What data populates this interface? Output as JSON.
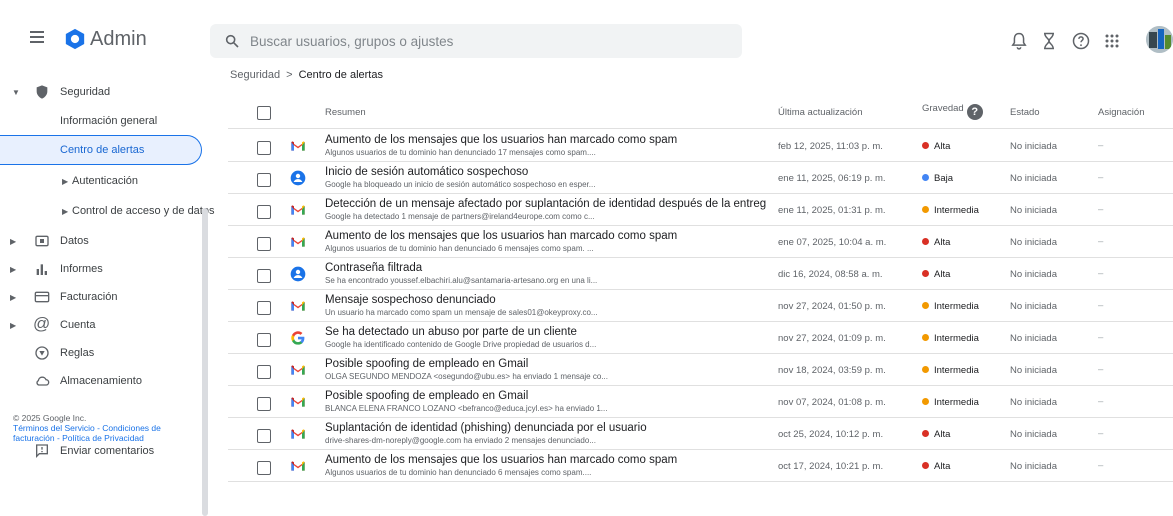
{
  "app": {
    "title": "Admin"
  },
  "search": {
    "placeholder": "Buscar usuarios, grupos o ajustes",
    "value": ""
  },
  "breadcrumb": {
    "parent": "Seguridad",
    "separator": ">",
    "current": "Centro de alertas"
  },
  "sidebar": {
    "security_label": "Seguridad",
    "items": [
      {
        "label": "Información general"
      },
      {
        "label": "Centro de alertas",
        "active": true
      },
      {
        "label": "Autenticación"
      },
      {
        "label": "Control de acceso y de datos"
      }
    ],
    "sections": [
      {
        "label": "Datos",
        "icon": "data-icon"
      },
      {
        "label": "Informes",
        "icon": "bar-chart-icon"
      },
      {
        "label": "Facturación",
        "icon": "credit-card-icon"
      },
      {
        "label": "Cuenta",
        "icon": "at-sign-icon"
      },
      {
        "label": "Reglas",
        "icon": "rules-icon"
      },
      {
        "label": "Almacenamiento",
        "icon": "cloud-icon"
      }
    ],
    "feedback_label": "Enviar comentarios",
    "footer": {
      "copyright": "© 2025 Google Inc.",
      "links_line1": "Términos del Servicio - Condiciones de",
      "links_line2": "facturación - Política de Privacidad"
    }
  },
  "table": {
    "headers": {
      "summary": "Resumen",
      "updated": "Última actualización",
      "severity": "Gravedad",
      "status": "Estado",
      "assignment": "Asignación"
    },
    "severity_colors": {
      "Alta": "#d93025",
      "Baja": "#4285f4",
      "Intermedia": "#f29900"
    },
    "rows": [
      {
        "service": "gmail",
        "title": "Aumento de los mensajes que los usuarios han marcado como spam",
        "desc": "Algunos usuarios de tu dominio han denunciado 17 mensajes como spam....",
        "date": "feb 12, 2025, 11:03 p. m.",
        "severity": "Alta",
        "status": "No iniciada",
        "assign": "–"
      },
      {
        "service": "account",
        "title": "Inicio de sesión automático sospechoso",
        "desc": "Google ha bloqueado un inicio de sesión automático sospechoso en esper...",
        "date": "ene 11, 2025, 06:19 p. m.",
        "severity": "Baja",
        "status": "No iniciada",
        "assign": "–"
      },
      {
        "service": "gmail",
        "title": "Detección de un mensaje afectado por suplantación de identidad después de la entreg",
        "desc": "Google ha detectado 1 mensaje de partners@ireland4europe.com como c...",
        "date": "ene 11, 2025, 01:31 p. m.",
        "severity": "Intermedia",
        "status": "No iniciada",
        "assign": "–"
      },
      {
        "service": "gmail",
        "title": "Aumento de los mensajes que los usuarios han marcado como spam",
        "desc": "Algunos usuarios de tu dominio han denunciado 6 mensajes como spam. ...",
        "date": "ene 07, 2025, 10:04 a. m.",
        "severity": "Alta",
        "status": "No iniciada",
        "assign": "–"
      },
      {
        "service": "account",
        "title": "Contraseña filtrada",
        "desc": "Se ha encontrado youssef.elbachiri.alu@santamaria-artesano.org en una li...",
        "date": "dic 16, 2024, 08:58 a. m.",
        "severity": "Alta",
        "status": "No iniciada",
        "assign": "–"
      },
      {
        "service": "gmail",
        "title": "Mensaje sospechoso denunciado",
        "desc": "Un usuario ha marcado como spam un mensaje de sales01@okeyproxy.co...",
        "date": "nov 27, 2024, 01:50 p. m.",
        "severity": "Intermedia",
        "status": "No iniciada",
        "assign": "–"
      },
      {
        "service": "google",
        "title": "Se ha detectado un abuso por parte de un cliente",
        "desc": "Google ha identificado contenido de Google Drive propiedad de usuarios d...",
        "date": "nov 27, 2024, 01:09 p. m.",
        "severity": "Intermedia",
        "status": "No iniciada",
        "assign": "–"
      },
      {
        "service": "gmail",
        "title": "Posible spoofing de empleado en Gmail",
        "desc": "OLGA SEGUNDO MENDOZA <osegundo@ubu.es> ha enviado 1 mensaje co...",
        "date": "nov 18, 2024, 03:59 p. m.",
        "severity": "Intermedia",
        "status": "No iniciada",
        "assign": "–"
      },
      {
        "service": "gmail",
        "title": "Posible spoofing de empleado en Gmail",
        "desc": "BLANCA ELENA FRANCO LOZANO <befranco@educa.jcyl.es> ha enviado 1...",
        "date": "nov 07, 2024, 01:08 p. m.",
        "severity": "Intermedia",
        "status": "No iniciada",
        "assign": "–"
      },
      {
        "service": "gmail",
        "title": "Suplantación de identidad (phishing) denunciada por el usuario",
        "desc": "drive-shares-dm-noreply@google.com ha enviado 2 mensajes denunciado...",
        "date": "oct 25, 2024, 10:12 p. m.",
        "severity": "Alta",
        "status": "No iniciada",
        "assign": "–"
      },
      {
        "service": "gmail",
        "title": "Aumento de los mensajes que los usuarios han marcado como spam",
        "desc": "Algunos usuarios de tu dominio han denunciado 6 mensajes como spam....",
        "date": "oct 17, 2024, 10:21 p. m.",
        "severity": "Alta",
        "status": "No iniciada",
        "assign": "–"
      }
    ]
  }
}
